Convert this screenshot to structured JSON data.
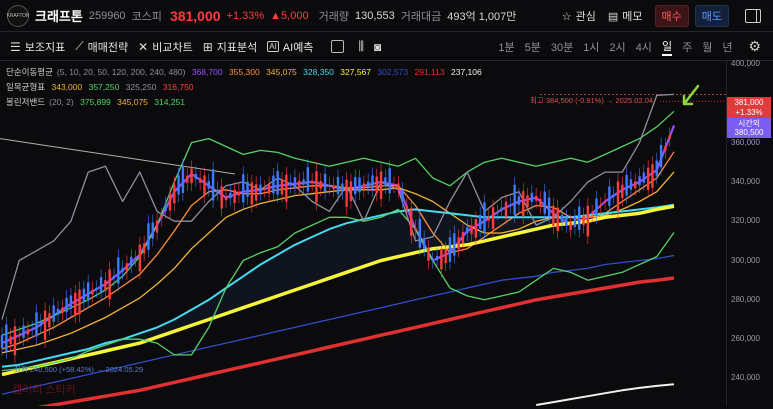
{
  "header": {
    "logo_text": "KRAFTON",
    "name": "크래프톤",
    "code": "259960",
    "market": "코스피",
    "price": "381,000",
    "change_pct": "+1.33%",
    "change_amt": "▲5,000",
    "volume_label": "거래량",
    "volume": "130,553",
    "amount_label": "거래대금",
    "amount": "493억 1,007만",
    "watch_label": "관심",
    "memo_label": "메모",
    "buy_label": "매수",
    "sell_label": "매도"
  },
  "toolbar": {
    "items": [
      "보조지표",
      "매매전략",
      "비교차트",
      "지표분석",
      "AI예측"
    ],
    "periods": [
      "1분",
      "5분",
      "30분",
      "1시",
      "2시",
      "4시",
      "일",
      "주",
      "월",
      "년"
    ],
    "active_period": "일"
  },
  "legend": {
    "ma": {
      "label": "단순이동평균",
      "params": "(5, 10, 20, 50, 120, 200, 240, 480)",
      "values": [
        "368,700",
        "355,300",
        "345,075",
        "328,350",
        "327,567",
        "302,573",
        "291,113",
        "237,106"
      ],
      "colors": [
        "#9b4dff",
        "#ff8c3a",
        "#f2b233",
        "#46d9f0",
        "#f5f53a",
        "#2f4fc8",
        "#e03030",
        "#f0f0f0"
      ]
    },
    "ichimoku": {
      "label": "일목균형표",
      "values": [
        "343,000",
        "357,250",
        "325,250",
        "316,750"
      ],
      "colors": [
        "#f2b233",
        "#55d06a",
        "#8f8fa0",
        "#ff4040"
      ]
    },
    "bollinger": {
      "label": "볼린저밴드",
      "params": "(20, 2)",
      "values": [
        "375,899",
        "345,075",
        "314,251"
      ],
      "colors": [
        "#55d06a",
        "#f2b233",
        "#55d06a"
      ]
    }
  },
  "annotations": {
    "high": "최고 384,500 (-0.91%) → 2025.02.04",
    "low": "최저 240,500 (+58.42%) → 2024.05.29",
    "watermark": "갤러리 스티커"
  },
  "price_box": {
    "price": "381,000",
    "pct": "+1.33%"
  },
  "time_box": {
    "label": "시간외",
    "price": "380,500"
  },
  "chart_data": {
    "type": "line",
    "title": "",
    "y_ticks": [
      240000,
      260000,
      280000,
      300000,
      320000,
      340000,
      360000,
      380000,
      400000
    ],
    "ylim": [
      226000,
      402000
    ],
    "grid": false,
    "last_price": 381000,
    "high": 384500,
    "low": 240500,
    "series": [
      {
        "name": "MA5",
        "color": "#9b4dff",
        "values": [
          258000,
          262000,
          266000,
          272000,
          278000,
          283000,
          288000,
          295000,
          303000,
          318000,
          335000,
          344000,
          338000,
          332000,
          335000,
          336000,
          338000,
          339000,
          340000,
          338000,
          336000,
          338000,
          340000,
          338000,
          316000,
          300000,
          304000,
          315000,
          320000,
          326000,
          330000,
          332000,
          324000,
          318000,
          322000,
          330000,
          336000,
          340000,
          346000,
          368700
        ]
      },
      {
        "name": "MA10",
        "color": "#ff8c3a",
        "values": [
          255000,
          258000,
          262000,
          266000,
          271000,
          276000,
          281000,
          287000,
          293000,
          303000,
          315000,
          328000,
          335000,
          336000,
          334000,
          334000,
          336000,
          337000,
          338000,
          338000,
          337000,
          337000,
          338000,
          338000,
          328000,
          314000,
          304000,
          306000,
          312000,
          318000,
          324000,
          328000,
          327000,
          322000,
          320000,
          324000,
          330000,
          336000,
          342000,
          355300
        ]
      },
      {
        "name": "MA20",
        "color": "#f2b233",
        "values": [
          253000,
          255000,
          257000,
          260000,
          263000,
          267000,
          271000,
          276000,
          281000,
          288000,
          296000,
          306000,
          314000,
          322000,
          326000,
          329000,
          331000,
          333000,
          334000,
          335000,
          336000,
          336000,
          336000,
          337000,
          334000,
          330000,
          324000,
          318000,
          314000,
          314000,
          316000,
          320000,
          322000,
          322000,
          322000,
          323000,
          326000,
          330000,
          335000,
          345075
        ]
      },
      {
        "name": "MA50",
        "color": "#46d9f0",
        "values": [
          246000,
          247000,
          249000,
          251000,
          253000,
          255000,
          258000,
          260000,
          263000,
          266000,
          270000,
          275000,
          280000,
          286000,
          292000,
          298000,
          303000,
          308000,
          312000,
          316000,
          319000,
          321000,
          323000,
          325000,
          326000,
          325000,
          324000,
          323000,
          322000,
          322000,
          322000,
          322000,
          322000,
          322000,
          323000,
          324000,
          325000,
          326000,
          327000,
          328350
        ]
      },
      {
        "name": "MA120",
        "color": "#f5f53a",
        "values": [
          242000,
          244000,
          246000,
          248000,
          250000,
          252000,
          254000,
          256000,
          258000,
          261000,
          264000,
          267000,
          270000,
          273000,
          276000,
          279000,
          282000,
          285000,
          288000,
          291000,
          294000,
          297000,
          300000,
          302000,
          304000,
          306000,
          307000,
          308000,
          310000,
          312000,
          314000,
          316000,
          318000,
          319000,
          320000,
          322000,
          323000,
          324000,
          326000,
          327567
        ]
      },
      {
        "name": "MA200",
        "color": "#2f4fc8",
        "values": [
          232000,
          234000,
          236000,
          238000,
          240000,
          242000,
          244000,
          246000,
          248000,
          250000,
          252000,
          254000,
          256000,
          258000,
          260000,
          262000,
          264000,
          266000,
          268000,
          270000,
          272000,
          274000,
          276000,
          278000,
          280000,
          282000,
          284000,
          286000,
          288000,
          290000,
          291000,
          292000,
          294000,
          295000,
          296000,
          298000,
          299000,
          300000,
          301000,
          302573
        ]
      },
      {
        "name": "MA240",
        "color": "#e03030",
        "values": [
          222000,
          223500,
          225000,
          226500,
          228000,
          229500,
          231000,
          232500,
          234000,
          236000,
          238000,
          240000,
          242000,
          244000,
          246000,
          248000,
          250000,
          252000,
          254000,
          256000,
          258000,
          260000,
          262000,
          264000,
          266000,
          268000,
          270000,
          272000,
          274000,
          276000,
          278000,
          280000,
          281500,
          283000,
          284500,
          286000,
          287500,
          289000,
          290000,
          291113
        ]
      },
      {
        "name": "MA480",
        "color": "#f0f0f0",
        "values": [
          null,
          null,
          null,
          null,
          null,
          null,
          null,
          null,
          null,
          null,
          null,
          null,
          null,
          null,
          null,
          null,
          null,
          null,
          null,
          null,
          null,
          null,
          null,
          null,
          null,
          null,
          null,
          null,
          null,
          null,
          null,
          226500,
          228000,
          229500,
          231000,
          232500,
          234000,
          235200,
          236200,
          237106
        ]
      },
      {
        "name": "BB Upper",
        "color": "#55d06a",
        "values": [
          262000,
          265000,
          268000,
          272000,
          276000,
          280000,
          285000,
          292000,
          302000,
          318000,
          340000,
          360000,
          362000,
          358000,
          354000,
          356000,
          355000,
          352000,
          350000,
          348000,
          350000,
          352000,
          350000,
          348000,
          352000,
          342000,
          338000,
          345000,
          350000,
          352000,
          350000,
          348000,
          350000,
          352000,
          350000,
          354000,
          358000,
          362000,
          368000,
          375899
        ]
      },
      {
        "name": "BB Lower",
        "color": "#55d06a",
        "values": [
          244000,
          245000,
          246000,
          248000,
          250000,
          254000,
          257000,
          260000,
          260000,
          258000,
          252000,
          252000,
          266000,
          286000,
          300000,
          304000,
          307000,
          314000,
          318000,
          322000,
          322000,
          320000,
          322000,
          326000,
          316000,
          300000,
          286000,
          282000,
          280000,
          282000,
          284000,
          290000,
          296000,
          294000,
          290000,
          292000,
          294000,
          298000,
          302000,
          314251
        ]
      },
      {
        "name": "Ichimoku Lagging",
        "color": "#8f8fa0",
        "values": [
          270000,
          300000,
          305000,
          310000,
          320000,
          345000,
          348000,
          330000,
          345000,
          325000,
          320000,
          320000,
          330000,
          338000,
          340000,
          336000,
          342000,
          338000,
          330000,
          325000,
          338000,
          320000,
          340000,
          336000,
          310000,
          312000,
          330000,
          345000,
          325000,
          332000,
          335000,
          318000,
          322000,
          330000,
          340000,
          345000,
          345000,
          360000,
          384000,
          384500
        ]
      }
    ]
  }
}
